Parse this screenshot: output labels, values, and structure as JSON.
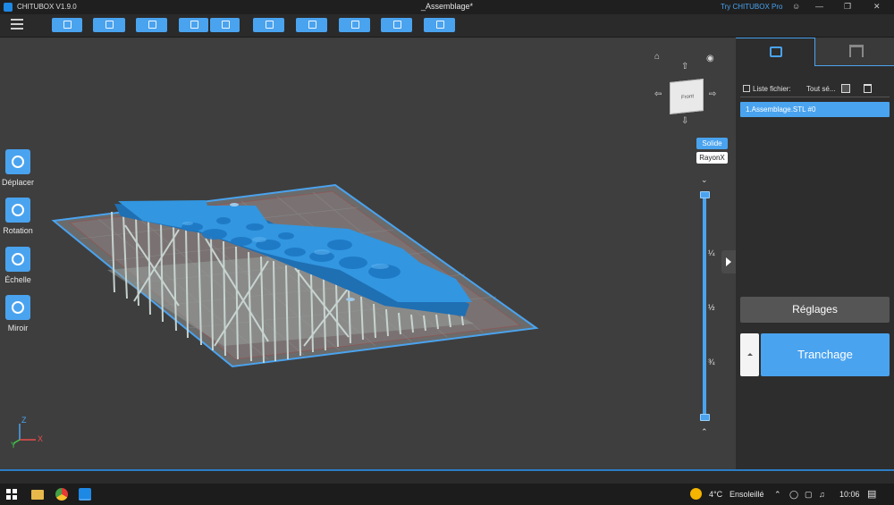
{
  "titlebar": {
    "app_name": "CHITUBOX V1.9.0",
    "document_title": "_Assemblage*",
    "try_pro": "Try CHITUBOX Pro"
  },
  "toolbar": {
    "buttons": [
      "open-file-icon",
      "save-icon",
      "layout-icon",
      "undo-icon",
      "redo-icon",
      "copy-icon",
      "support-icon",
      "drop-icon",
      "hollow-icon",
      "lock-icon"
    ]
  },
  "left_tools": [
    {
      "label": "Déplacer",
      "icon": "move-icon"
    },
    {
      "label": "Rotation",
      "icon": "rotate-icon"
    },
    {
      "label": "Échelle",
      "icon": "scale-icon"
    },
    {
      "label": "Miroir",
      "icon": "mirror-icon"
    }
  ],
  "viewcube": {
    "face_label": "Front",
    "side_label": "Left"
  },
  "view_modes": {
    "solid": "Solide",
    "xray": "RayonX"
  },
  "slider": {
    "fractions": [
      "¼",
      "½",
      "¾"
    ]
  },
  "panel": {
    "file_list_label": "Liste fichier:",
    "select_all": "Tout sé...",
    "files": [
      "1.Assemblage.STL #0"
    ],
    "settings_button": "Réglages",
    "slice_button": "Tranchage"
  },
  "taskbar": {
    "weather_temp": "4°C",
    "weather_text": "Ensoleillé",
    "time": "10:06"
  },
  "colors": {
    "accent": "#4aa3ef",
    "model": "#2f8fd8",
    "supports": "#c9d6d2"
  }
}
